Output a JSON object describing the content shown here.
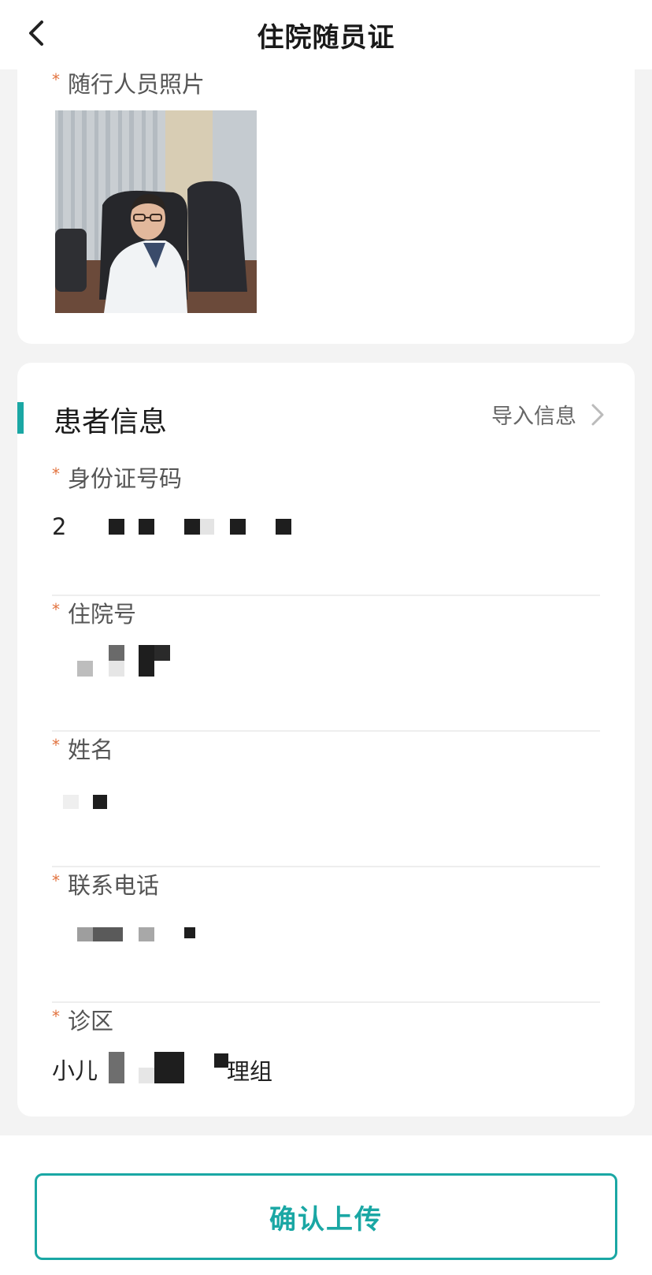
{
  "header": {
    "title": "住院随员证",
    "back_icon": "chevron-left-icon"
  },
  "photo_section": {
    "required_mark": "*",
    "label": "随行人员照片"
  },
  "patient_section": {
    "title": "患者信息",
    "import_label": "导入信息",
    "import_icon": "chevron-right-icon",
    "accent_color": "#1aa7a4",
    "fields": [
      {
        "label": "身份证号码",
        "value": "2"
      },
      {
        "label": "住院号",
        "value": ""
      },
      {
        "label": "姓名",
        "value": ""
      },
      {
        "label": "联系电话",
        "value": ""
      },
      {
        "label": "诊区",
        "value": "小儿",
        "value_suffix": "理组"
      }
    ]
  },
  "footer": {
    "confirm_label": "确认上传",
    "confirm_color": "#1aa7a4"
  },
  "colors": {
    "required_mark": "#e2733f",
    "background": "#f3f3f3"
  }
}
